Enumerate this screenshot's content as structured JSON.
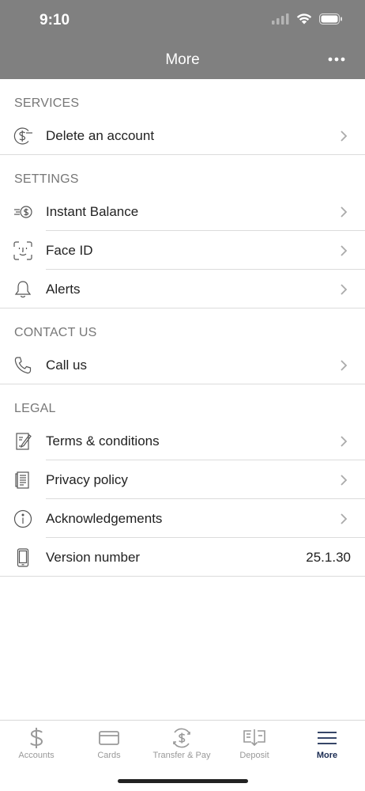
{
  "status": {
    "time": "9:10"
  },
  "nav": {
    "title": "More"
  },
  "sections": [
    {
      "header": "SERVICES",
      "rows": [
        {
          "label": "Delete an account",
          "icon": "dollar-circle-minus-icon"
        }
      ]
    },
    {
      "header": "SETTINGS",
      "rows": [
        {
          "label": "Instant Balance",
          "icon": "instant-balance-icon"
        },
        {
          "label": "Face ID",
          "icon": "face-id-icon"
        },
        {
          "label": "Alerts",
          "icon": "bell-icon"
        }
      ]
    },
    {
      "header": "CONTACT US",
      "rows": [
        {
          "label": "Call us",
          "icon": "phone-icon"
        }
      ]
    },
    {
      "header": "LEGAL",
      "rows": [
        {
          "label": "Terms & conditions",
          "icon": "document-pen-icon"
        },
        {
          "label": "Privacy policy",
          "icon": "document-lines-icon"
        },
        {
          "label": "Acknowledgements",
          "icon": "info-circle-icon"
        },
        {
          "label": "Version number",
          "icon": "phone-device-icon",
          "value": "25.1.30"
        }
      ]
    }
  ],
  "tabbar": {
    "tabs": [
      {
        "label": "Accounts",
        "icon": "dollar-sign-icon"
      },
      {
        "label": "Cards",
        "icon": "card-icon"
      },
      {
        "label": "Transfer & Pay",
        "icon": "transfer-dollar-icon"
      },
      {
        "label": "Deposit",
        "icon": "check-deposit-icon"
      },
      {
        "label": "More",
        "icon": "hamburger-menu-icon"
      }
    ],
    "active_color": "#1a2b52",
    "inactive_color": "#999999"
  }
}
